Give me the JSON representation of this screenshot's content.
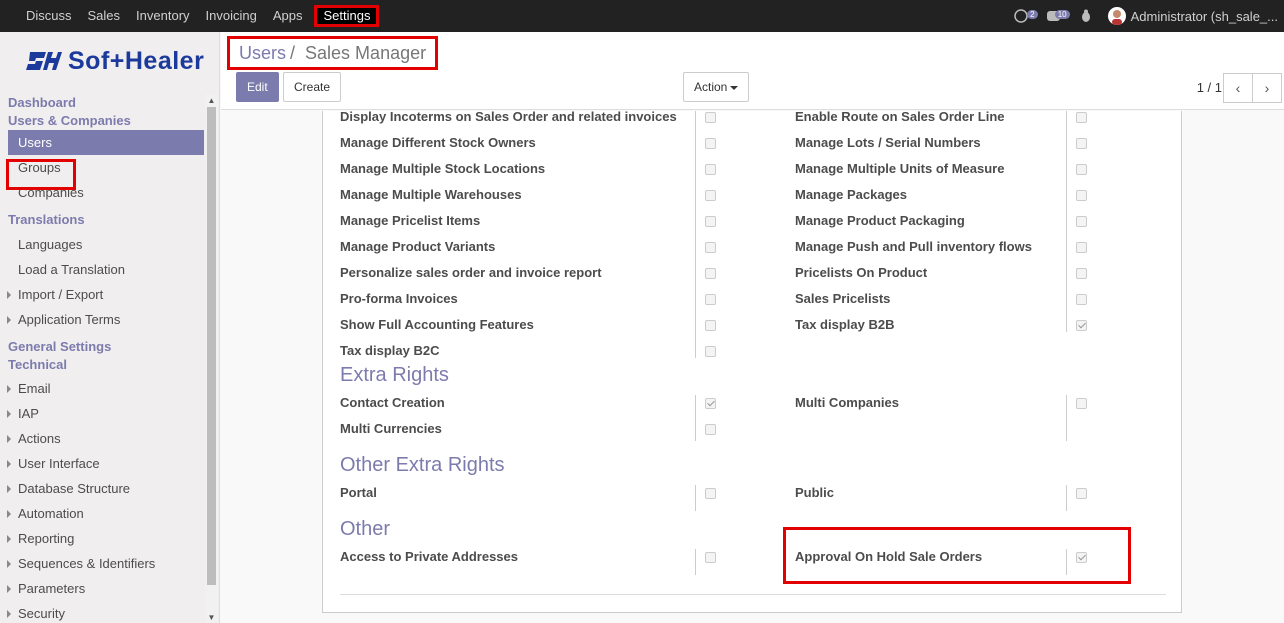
{
  "topbar": {
    "menu": [
      "Discuss",
      "Sales",
      "Inventory",
      "Invoicing",
      "Apps",
      "Settings"
    ],
    "active_index": 5,
    "chat_count": "2",
    "activity_count": "10",
    "user": "Administrator (sh_sale_..."
  },
  "brand": {
    "logo_text": "Sof+Healer",
    "logo_mark": "SH"
  },
  "sidebar": {
    "dashboard": "Dashboard",
    "users_companies": "Users & Companies",
    "users": "Users",
    "groups": "Groups",
    "companies": "Companies",
    "translations": "Translations",
    "languages": "Languages",
    "load_translation": "Load a Translation",
    "import_export": "Import / Export",
    "application_terms": "Application Terms",
    "general_settings": "General Settings",
    "technical": "Technical",
    "email": "Email",
    "iap": "IAP",
    "actions": "Actions",
    "user_interface": "User Interface",
    "database_structure": "Database Structure",
    "automation": "Automation",
    "reporting": "Reporting",
    "sequences": "Sequences & Identifiers",
    "parameters": "Parameters",
    "security": "Security"
  },
  "control": {
    "breadcrumb_parent": "Users",
    "breadcrumb_sep": "/",
    "breadcrumb_current": "Sales Manager",
    "edit": "Edit",
    "create": "Create",
    "action": "Action",
    "pager": "1 / 1"
  },
  "rights": {
    "rows": [
      {
        "left": "Display Incoterms on Sales Order and related invoices",
        "left_checked": false,
        "right": "Enable Route on Sales Order Line",
        "right_checked": false
      },
      {
        "left": "Manage Different Stock Owners",
        "left_checked": false,
        "right": "Manage Lots / Serial Numbers",
        "right_checked": false
      },
      {
        "left": "Manage Multiple Stock Locations",
        "left_checked": false,
        "right": "Manage Multiple Units of Measure",
        "right_checked": false
      },
      {
        "left": "Manage Multiple Warehouses",
        "left_checked": false,
        "right": "Manage Packages",
        "right_checked": false
      },
      {
        "left": "Manage Pricelist Items",
        "left_checked": false,
        "right": "Manage Product Packaging",
        "right_checked": false
      },
      {
        "left": "Manage Product Variants",
        "left_checked": false,
        "right": "Manage Push and Pull inventory flows",
        "right_checked": false
      },
      {
        "left": "Personalize sales order and invoice report",
        "left_checked": false,
        "right": "Pricelists On Product",
        "right_checked": false
      },
      {
        "left": "Pro-forma Invoices",
        "left_checked": false,
        "right": "Sales Pricelists",
        "right_checked": false
      },
      {
        "left": "Show Full Accounting Features",
        "left_checked": false,
        "right": "Tax display B2B",
        "right_checked": true
      },
      {
        "left": "Tax display B2C",
        "left_checked": false,
        "right": "",
        "right_checked": null
      }
    ]
  },
  "extra_rights": {
    "title": "Extra Rights",
    "rows": [
      {
        "left": "Contact Creation",
        "left_checked": true,
        "right": "Multi Companies",
        "right_checked": false
      },
      {
        "left": "Multi Currencies",
        "left_checked": false,
        "right": "",
        "right_checked": null
      }
    ]
  },
  "other_extra_rights": {
    "title": "Other Extra Rights",
    "rows": [
      {
        "left": "Portal",
        "left_checked": false,
        "right": "Public",
        "right_checked": false
      }
    ]
  },
  "other": {
    "title": "Other",
    "rows": [
      {
        "left": "Access to Private Addresses",
        "left_checked": false,
        "right": "Approval On Hold Sale Orders",
        "right_checked": true
      }
    ]
  },
  "colors": {
    "accent": "#7c7bad",
    "highlight": "#e30000",
    "navbar": "#222222"
  }
}
